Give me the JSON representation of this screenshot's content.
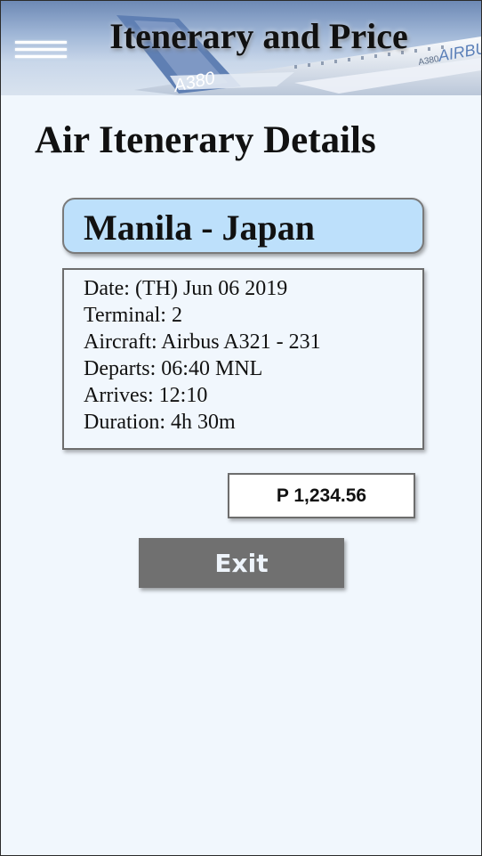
{
  "header": {
    "title": "Itenerary and Price",
    "menu_icon": "hamburger-menu-icon",
    "background_image": "airbus-a380-plane",
    "plane_markings": [
      "A380",
      "A380",
      "AIRBUS"
    ]
  },
  "main": {
    "page_title": "Air Itenerary Details",
    "route": "Manila - Japan",
    "details": [
      "Date: (TH) Jun 06 2019",
      "Terminal: 2",
      "Aircraft: Airbus A321 - 231",
      "Departs: 06:40 MNL",
      "Arrives: 12:10",
      "Duration: 4h 30m"
    ],
    "price": "P 1,234.56",
    "exit_label": "Exit"
  },
  "colors": {
    "background": "#f1f7fd",
    "route_card": "#bde0fb",
    "exit_button": "#707070"
  }
}
